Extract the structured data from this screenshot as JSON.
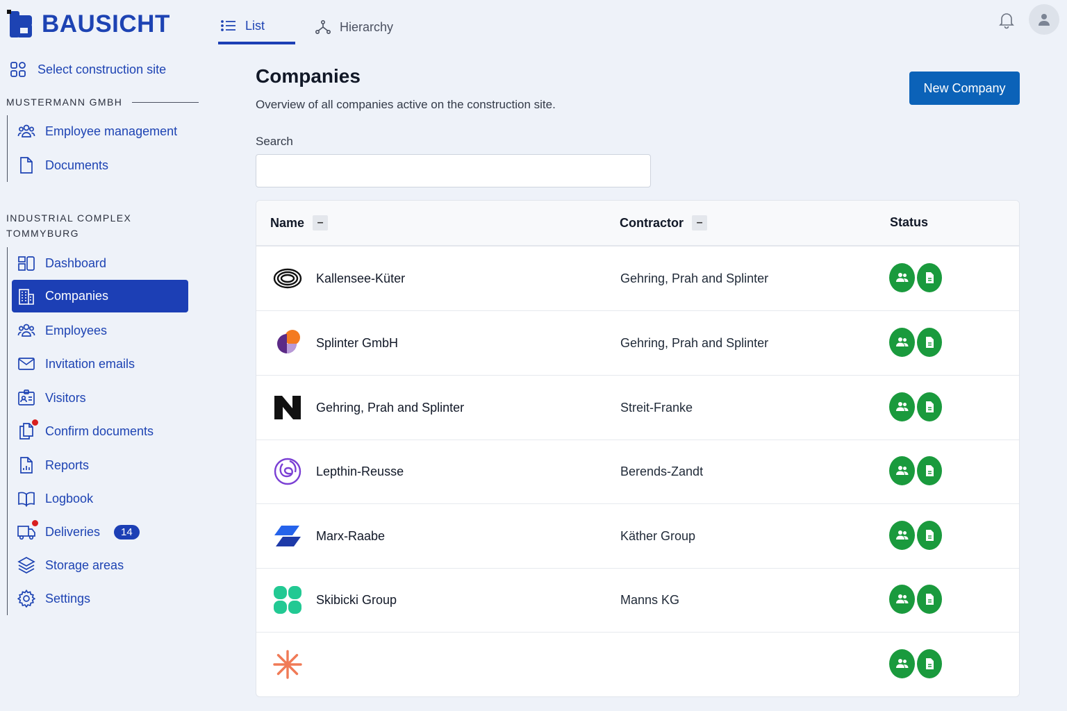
{
  "app": {
    "brand": "BAUSICHT"
  },
  "colors": {
    "accent": "#1c3fb5",
    "primary_button": "#0b62b8",
    "status_ok": "#1a9a3d",
    "alert_dot": "#d81f1f"
  },
  "top_tabs": [
    {
      "label": "List",
      "icon": "list-icon",
      "active": true
    },
    {
      "label": "Hierarchy",
      "icon": "hierarchy-icon",
      "active": false
    }
  ],
  "sidebar": {
    "site_select": "Select construction site",
    "company_section": "MUSTERMANN GMBH",
    "company_items": [
      {
        "label": "Employee management",
        "icon": "users-icon"
      },
      {
        "label": "Documents",
        "icon": "document-icon"
      }
    ],
    "site_section_line1": "INDUSTRIAL COMPLEX",
    "site_section_line2": "TOMMYBURG",
    "site_items": [
      {
        "label": "Dashboard",
        "icon": "dashboard-icon"
      },
      {
        "label": "Companies",
        "icon": "building-icon",
        "active": true
      },
      {
        "label": "Employees",
        "icon": "users-icon"
      },
      {
        "label": "Invitation emails",
        "icon": "mail-icon"
      },
      {
        "label": "Visitors",
        "icon": "visitor-badge-icon"
      },
      {
        "label": "Confirm documents",
        "icon": "documents-icon",
        "alert": true
      },
      {
        "label": "Reports",
        "icon": "report-icon"
      },
      {
        "label": "Logbook",
        "icon": "book-icon"
      },
      {
        "label": "Deliveries",
        "icon": "truck-icon",
        "alert": true,
        "badge": "14"
      },
      {
        "label": "Storage areas",
        "icon": "layers-icon"
      },
      {
        "label": "Settings",
        "icon": "gear-icon"
      }
    ]
  },
  "main": {
    "title": "Companies",
    "subtitle": "Overview of all companies active on the construction site.",
    "new_button": "New Company",
    "search_label": "Search",
    "search_value": "",
    "columns": {
      "name": "Name",
      "contractor": "Contractor",
      "status": "Status",
      "sort_symbol": "–"
    },
    "rows": [
      {
        "name": "Kallensee-Küter",
        "contractor": "Gehring, Prah and Splinter",
        "logo": "rings-logo"
      },
      {
        "name": "Splinter GmbH",
        "contractor": "Gehring, Prah and Splinter",
        "logo": "circles-logo"
      },
      {
        "name": "Gehring, Prah and Splinter",
        "contractor": "Streit-Franke",
        "logo": "n-logo"
      },
      {
        "name": "Lepthin-Reusse",
        "contractor": "Berends-Zandt",
        "logo": "spiral-logo"
      },
      {
        "name": "Marx-Raabe",
        "contractor": "Käther Group",
        "logo": "parallelogram-logo"
      },
      {
        "name": "Skibicki Group",
        "contractor": "Manns KG",
        "logo": "clover-logo"
      },
      {
        "name": "",
        "contractor": "",
        "logo": "asterisk-logo"
      }
    ]
  }
}
